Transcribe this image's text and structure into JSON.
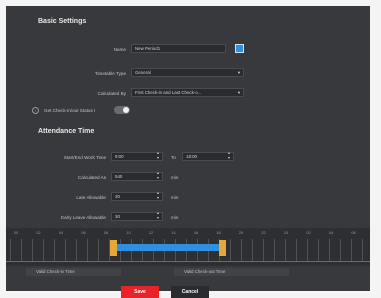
{
  "basic_settings": {
    "title": "Basic Settings",
    "name_label": "Name",
    "name_value": "New Period1",
    "color_swatch": "#2f8fe0",
    "timetable_type_label": "Timetable Type",
    "timetable_type_value": "General",
    "calculated_by_label": "Calculated By",
    "calculated_by_value": "First Check-in and Last Check-o...",
    "checkin_label": "Get Check-in/out Status I"
  },
  "attendance_time": {
    "title": "Attendance Time",
    "work_time_label": "Start/End Work Time",
    "start_value": "9:00",
    "to_label": "To",
    "end_value": "18:00",
    "calculated_as_label": "Calculated As",
    "calculated_as_value": "540",
    "late_label": "Late Allowable",
    "late_value": "30",
    "early_label": "Early Leave Allowable",
    "early_value": "30",
    "unit": "min"
  },
  "timeline": {
    "ticks": [
      "00",
      "02",
      "04",
      "06",
      "08",
      "10",
      "12",
      "14",
      "16",
      "18",
      "20",
      "22",
      "24",
      "02",
      "04",
      "06"
    ],
    "work_start_hour": 9,
    "work_end_hour": 18,
    "checkin_label": "Valid Check-in Time",
    "checkout_label": "Valid Check-out Time"
  },
  "footer": {
    "save_label": "Save",
    "cancel_label": "Cancel",
    "save_color": "#e8232a"
  }
}
